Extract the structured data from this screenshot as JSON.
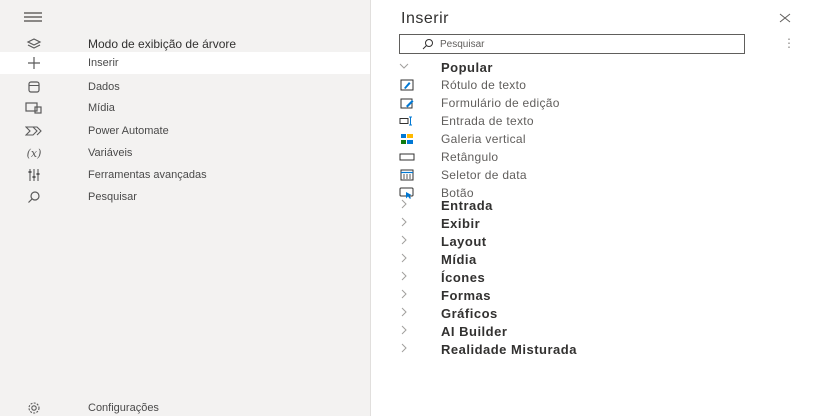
{
  "nav": {
    "items": [
      {
        "label": "Modo de exibição de árvore",
        "icon": "layers-icon"
      },
      {
        "label": "Inserir",
        "icon": "plus-icon"
      },
      {
        "label": "Dados",
        "icon": "database-icon"
      },
      {
        "label": "Mídia",
        "icon": "media-icon"
      },
      {
        "label": "Power Automate",
        "icon": "power-automate-icon"
      },
      {
        "label": "Variáveis",
        "icon": "variables-icon"
      },
      {
        "label": "Ferramentas avançadas",
        "icon": "tools-icon"
      },
      {
        "label": "Pesquisar",
        "icon": "search-icon"
      }
    ],
    "variables_glyph": "(x)",
    "settings_label": "Configurações"
  },
  "panel": {
    "title": "Inserir",
    "search_placeholder": "Pesquisar",
    "more_glyph": "⋮",
    "popular": {
      "label": "Popular",
      "controls": [
        {
          "label": "Rótulo de texto",
          "icon": "text-label-icon"
        },
        {
          "label": "Formulário de edição",
          "icon": "edit-form-icon"
        },
        {
          "label": "Entrada de texto",
          "icon": "text-input-icon"
        },
        {
          "label": "Galeria vertical",
          "icon": "vertical-gallery-icon"
        },
        {
          "label": "Retângulo",
          "icon": "rectangle-icon"
        },
        {
          "label": "Seletor de data",
          "icon": "date-picker-icon"
        },
        {
          "label": "Botão",
          "icon": "button-icon"
        }
      ]
    },
    "categories": [
      {
        "label": "Entrada"
      },
      {
        "label": "Exibir"
      },
      {
        "label": "Layout"
      },
      {
        "label": "Mídia"
      },
      {
        "label": "Ícones"
      },
      {
        "label": "Formas"
      },
      {
        "label": "Gráficos"
      },
      {
        "label": "AI Builder"
      },
      {
        "label": "Realidade Misturada"
      }
    ]
  },
  "colors": {
    "accent": "#0078d4",
    "sidebar_bg": "#f3f2f1",
    "text": "#323130"
  }
}
